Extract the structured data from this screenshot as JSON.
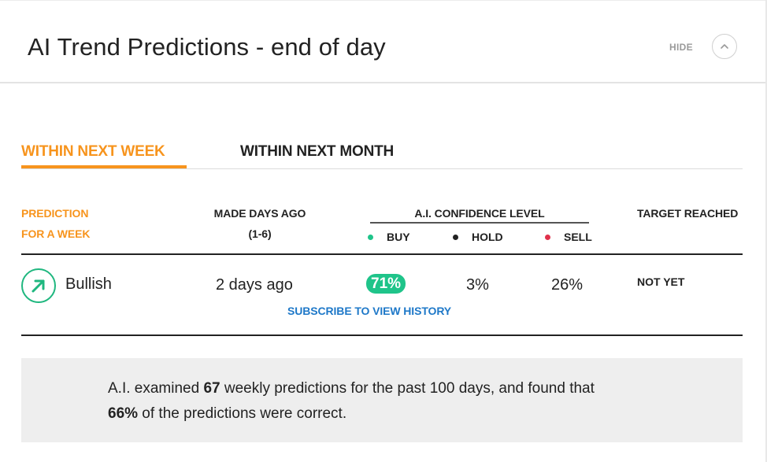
{
  "header": {
    "title": "AI Trend Predictions - end of day",
    "hide_label": "HIDE",
    "collapse_icon": "chevron-up-icon"
  },
  "tabs": [
    {
      "label": "WITHIN NEXT WEEK",
      "active": true
    },
    {
      "label": "WITHIN NEXT MONTH",
      "active": false
    }
  ],
  "columns": {
    "prediction": {
      "line1": "PREDICTION",
      "line2": "FOR A WEEK"
    },
    "made_days_ago": {
      "line1": "MADE DAYS AGO",
      "line2": "(1-6)"
    },
    "confidence": "A.I. CONFIDENCE LEVEL",
    "target": "TARGET REACHED"
  },
  "legend": [
    {
      "label": "BUY",
      "color": "#1fc48a"
    },
    {
      "label": "HOLD",
      "color": "#222222"
    },
    {
      "label": "SELL",
      "color": "#e0314b"
    }
  ],
  "row": {
    "trend_icon": "arrow-up-right-icon",
    "trend": "Bullish",
    "days_ago": "2 days ago",
    "buy": "71%",
    "hold": "3%",
    "sell": "26%",
    "target": "NOT YET"
  },
  "subscribe_link": "SUBSCRIBE TO VIEW HISTORY",
  "summary": {
    "part1": "A.I. examined ",
    "count": "67",
    "part2": " weekly predictions for the past 100 days, and found that",
    "percent": "66%",
    "part3": " of the predictions were correct."
  },
  "colors": {
    "accent": "#f7941d",
    "positive": "#1fc48a",
    "link": "#1e78c8",
    "negative": "#e0314b"
  }
}
